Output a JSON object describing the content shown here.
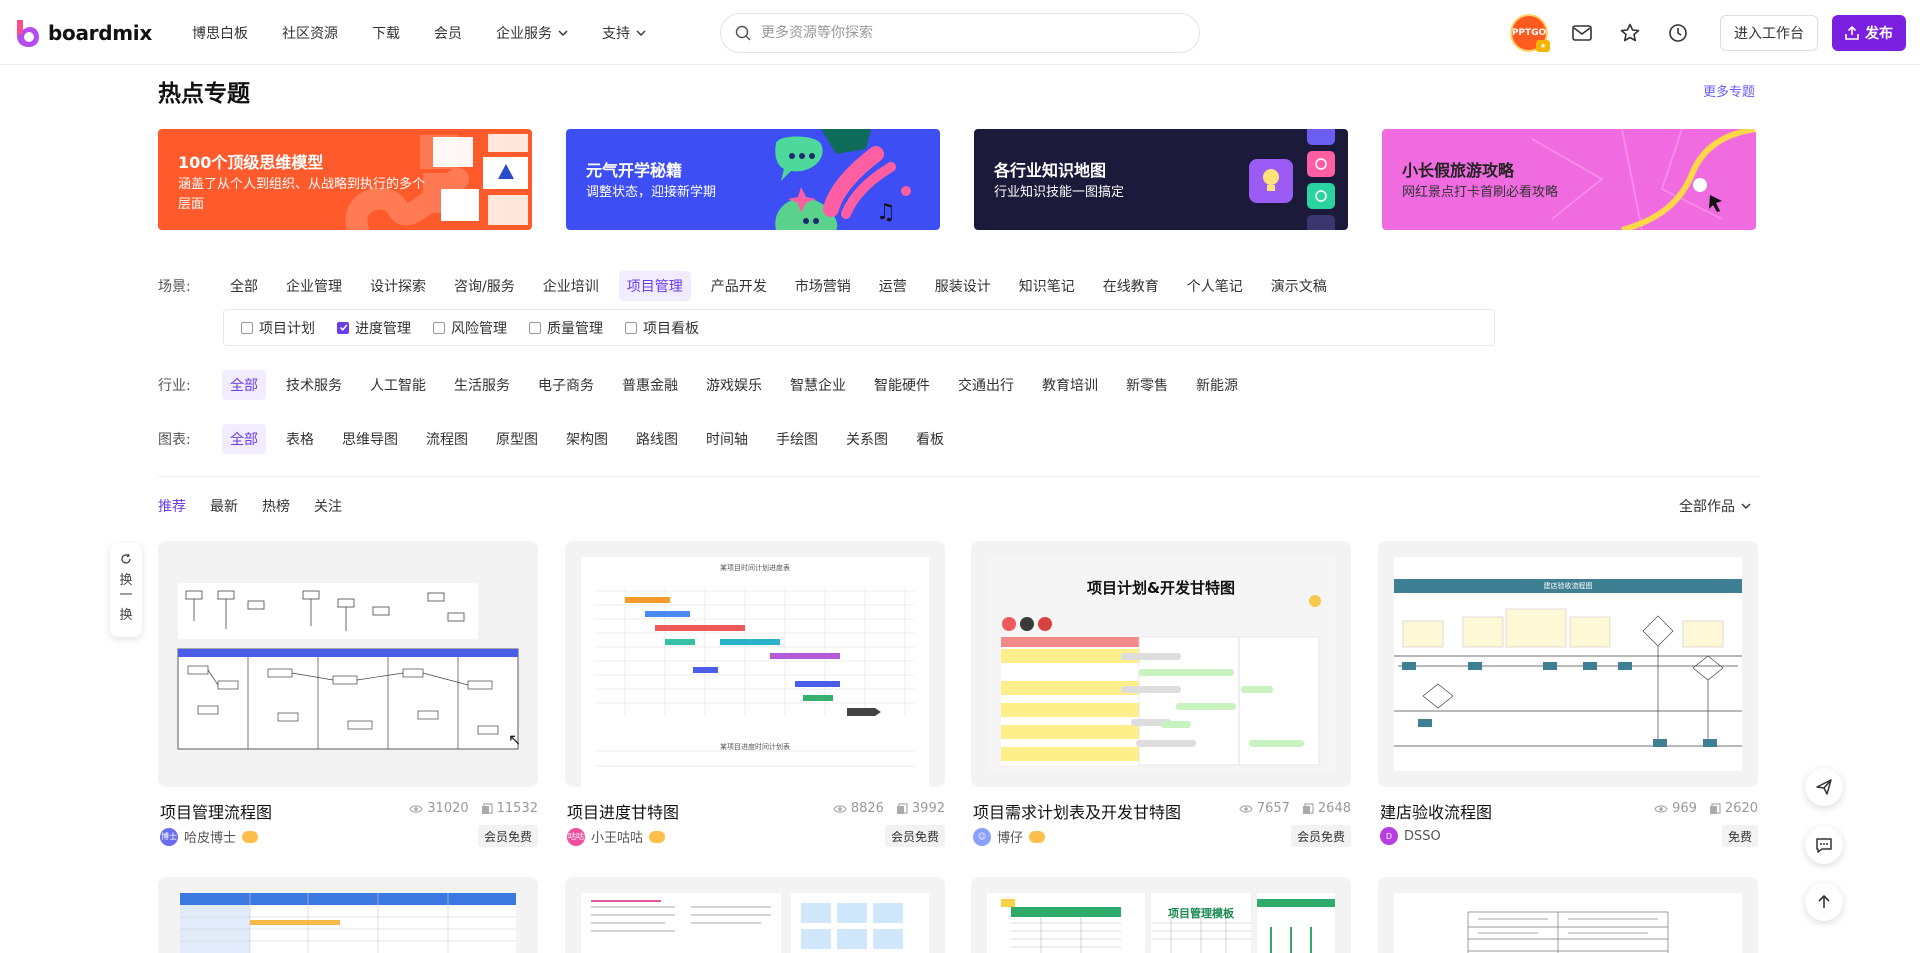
{
  "brand": {
    "name": "boardmix"
  },
  "nav": {
    "items": [
      {
        "label": "博思白板",
        "dropdown": false
      },
      {
        "label": "社区资源",
        "dropdown": false
      },
      {
        "label": "下载",
        "dropdown": false
      },
      {
        "label": "会员",
        "dropdown": false
      },
      {
        "label": "企业服务",
        "dropdown": true
      },
      {
        "label": "支持",
        "dropdown": true
      }
    ]
  },
  "search": {
    "placeholder": "更多资源等你探索",
    "value": ""
  },
  "user": {
    "avatar_text": "PPTGO"
  },
  "header_actions": {
    "workspace_label": "进入工作台",
    "publish_label": "发布"
  },
  "section": {
    "title": "热点专题",
    "more_label": "更多专题"
  },
  "banners": [
    {
      "title": "100个顶级思维模型",
      "subtitle": "涵盖了从个人到组织、从战略到执行的多个层面",
      "color": "#ff5a2c"
    },
    {
      "title": "元气开学秘籍",
      "subtitle": "调整状态，迎接新学期",
      "color": "#3d4ef5"
    },
    {
      "title": "各行业知识地图",
      "subtitle": "行业知识技能一图搞定",
      "color": "#1c1a3b"
    },
    {
      "title": "小长假旅游攻略",
      "subtitle": "网红景点打卡首刷必看攻略",
      "color": "#f06ae0"
    }
  ],
  "filters": {
    "scene": {
      "label": "场景:",
      "options": [
        "全部",
        "企业管理",
        "设计探索",
        "咨询/服务",
        "企业培训",
        "项目管理",
        "产品开发",
        "市场营销",
        "运营",
        "服装设计",
        "知识笔记",
        "在线教育",
        "个人笔记",
        "演示文稿"
      ],
      "active": "项目管理",
      "sub_options": [
        {
          "label": "项目计划",
          "checked": false
        },
        {
          "label": "进度管理",
          "checked": true
        },
        {
          "label": "风险管理",
          "checked": false
        },
        {
          "label": "质量管理",
          "checked": false
        },
        {
          "label": "项目看板",
          "checked": false
        }
      ]
    },
    "industry": {
      "label": "行业:",
      "options": [
        "全部",
        "技术服务",
        "人工智能",
        "生活服务",
        "电子商务",
        "普惠金融",
        "游戏娱乐",
        "智慧企业",
        "智能硬件",
        "交通出行",
        "教育培训",
        "新零售",
        "新能源"
      ],
      "active": "全部"
    },
    "chart": {
      "label": "图表:",
      "options": [
        "全部",
        "表格",
        "思维导图",
        "流程图",
        "原型图",
        "架构图",
        "路线图",
        "时间轴",
        "手绘图",
        "关系图",
        "看板"
      ],
      "active": "全部"
    }
  },
  "sort_tabs": {
    "items": [
      "推荐",
      "最新",
      "热榜",
      "关注"
    ],
    "active": "推荐",
    "scope_label": "全部作品"
  },
  "refresh": {
    "label": [
      "换",
      "一",
      "换"
    ]
  },
  "cards": [
    {
      "title": "项目管理流程图",
      "views": "31020",
      "copies": "11532",
      "author": "哈皮博士",
      "author_badge": "博士",
      "avatar_color": "#6a6df0",
      "badge": "会员免费"
    },
    {
      "title": "项目进度甘特图",
      "views": "8826",
      "copies": "3992",
      "author": "小王咕咕",
      "author_badge": "咕咕",
      "avatar_color": "#f04fa0",
      "badge": "会员免费"
    },
    {
      "title": "项目需求计划表及开发甘特图",
      "views": "7657",
      "copies": "2648",
      "author": "博仔",
      "author_badge": "",
      "avatar_color": "#8aa0ff",
      "badge": "会员免费"
    },
    {
      "title": "建店验收流程图",
      "views": "969",
      "copies": "2620",
      "author": "DSSO",
      "author_badge": "D",
      "avatar_color": "#b83de0",
      "badge": "免费"
    }
  ],
  "thumb_texts": {
    "gantt_title": "某项目时间计划进度表",
    "gantt_footer": "某项目进度时间计划表",
    "plan_title": "项目计划&开发甘特图",
    "store_title": "建店验收流程图",
    "board_title": "项目管理模板"
  }
}
